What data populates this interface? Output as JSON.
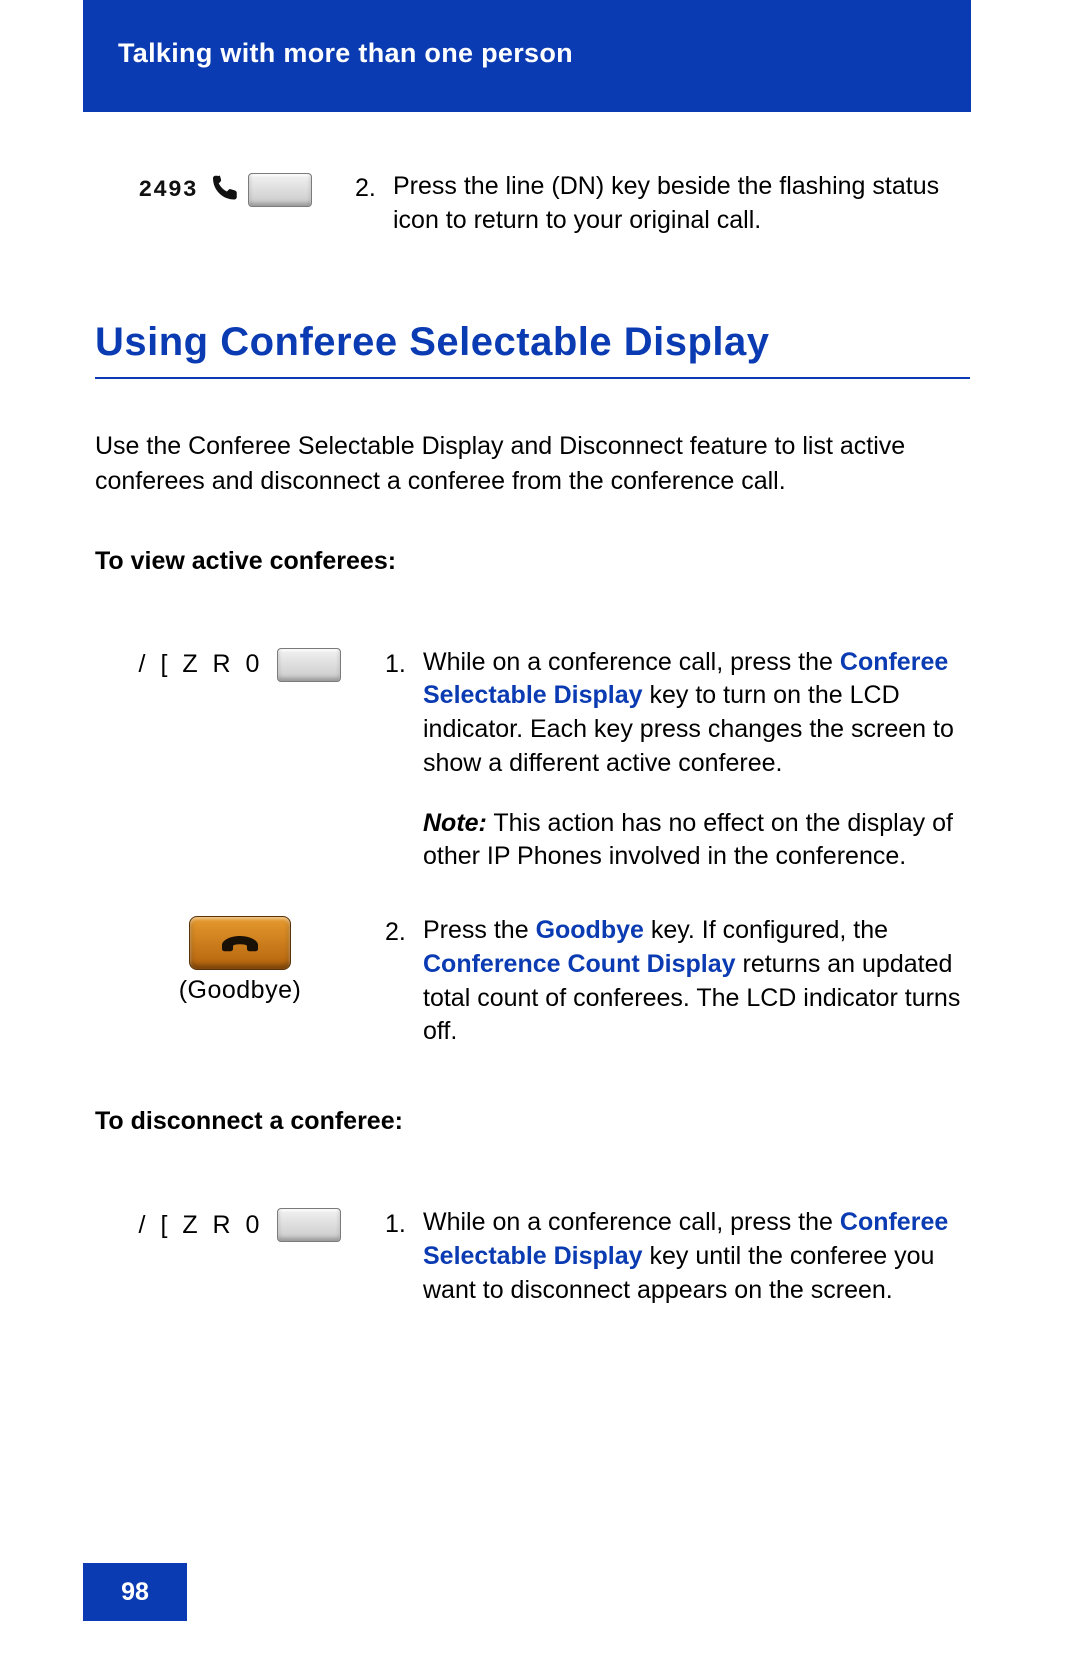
{
  "colors": {
    "brand_blue": "#0b3bb2",
    "goodbye_orange": "#d0842d"
  },
  "header": {
    "running_head": "Talking with more than one person"
  },
  "footer": {
    "page_number": "98"
  },
  "prev_section_step": {
    "lcd_number": "2493",
    "num": "2.",
    "text": "Press the line (DN) key beside the flashing status icon to return to your original call."
  },
  "section": {
    "title": "Using Conferee Selectable Display",
    "intro": "Use the Conferee Selectable Display and Disconnect feature to list active conferees and disconnect a conferee from the conference call.",
    "view": {
      "title": "To view active conferees:",
      "key_code": "/ [ Z R 0",
      "step1": {
        "num": "1.",
        "a": "While on a conference call, press the ",
        "key": "Conferee Selectable Display",
        "b": " key to turn on the LCD indicator. Each key press changes the screen to show a different active conferee.",
        "note_lead": "Note:",
        "note": " This action has no effect on the display of other IP Phones involved in the conference."
      },
      "step2": {
        "num": "2.",
        "a": "Press the ",
        "key1": "Goodbye",
        "b": " key. If configured, the ",
        "key2": "Conference Count Display",
        "c": " returns an updated total count of conferees. The LCD indicator turns off.",
        "button_label": "(Goodbye)"
      }
    },
    "disconnect": {
      "title": "To disconnect a conferee:",
      "key_code": "/ [ Z R 0",
      "step1": {
        "num": "1.",
        "a": "While on a conference call, press the ",
        "key": "Conferee Selectable Display",
        "b": " key until the conferee you want to disconnect appears on the screen."
      }
    }
  }
}
